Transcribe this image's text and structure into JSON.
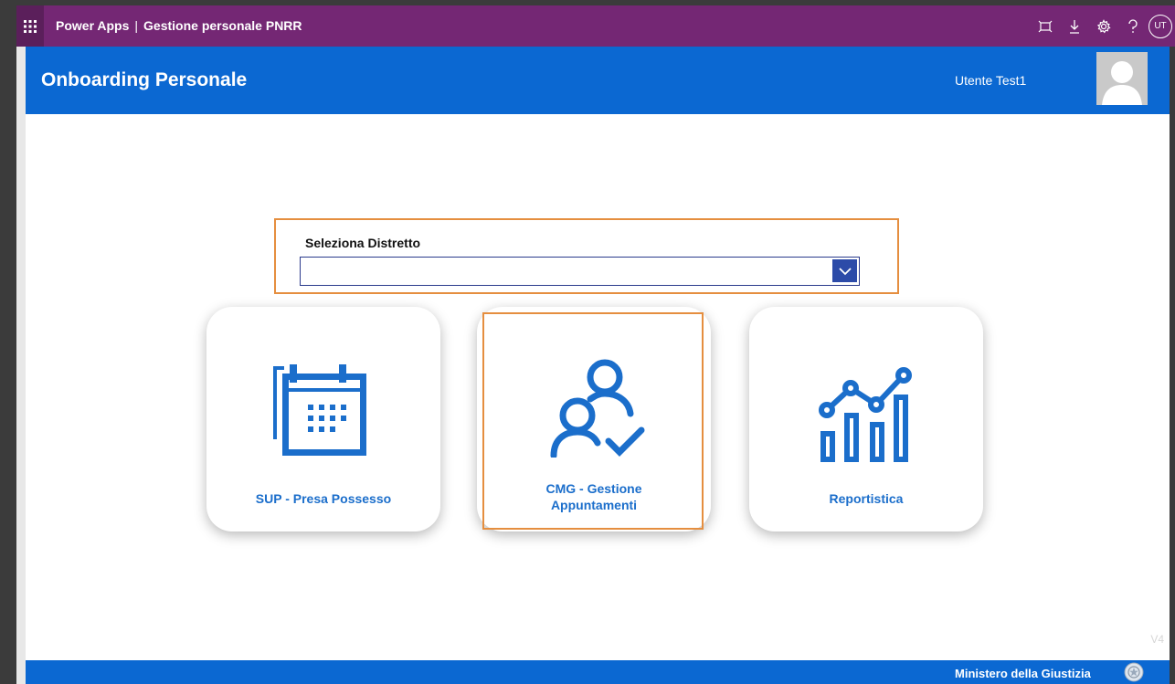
{
  "suitebar": {
    "app_name": "Power Apps",
    "separator": "|",
    "app_title": "Gestione personale PNRR",
    "avatar_initials": "UT",
    "icons": [
      "waffle-icon",
      "fit-screen-icon",
      "download-icon",
      "settings-icon",
      "help-icon"
    ]
  },
  "header": {
    "title": "Onboarding Personale",
    "user_name": "Utente Test1"
  },
  "district": {
    "label": "Seleziona Distretto",
    "value": ""
  },
  "cards": [
    {
      "label": "SUP - Presa Possesso",
      "icon": "calendar-icon"
    },
    {
      "label_line1": "CMG - Gestione",
      "label_line2": "Appuntamenti",
      "icon": "people-check-icon"
    },
    {
      "label": "Reportistica",
      "icon": "bar-chart-trend-icon"
    }
  ],
  "version": "V4",
  "footer": {
    "ministry": "Ministero della Giustizia"
  },
  "colors": {
    "suitebar": "#742774",
    "header": "#0b68d2",
    "accent_blue": "#1b6ecb",
    "highlight_orange": "#e58e3f"
  }
}
